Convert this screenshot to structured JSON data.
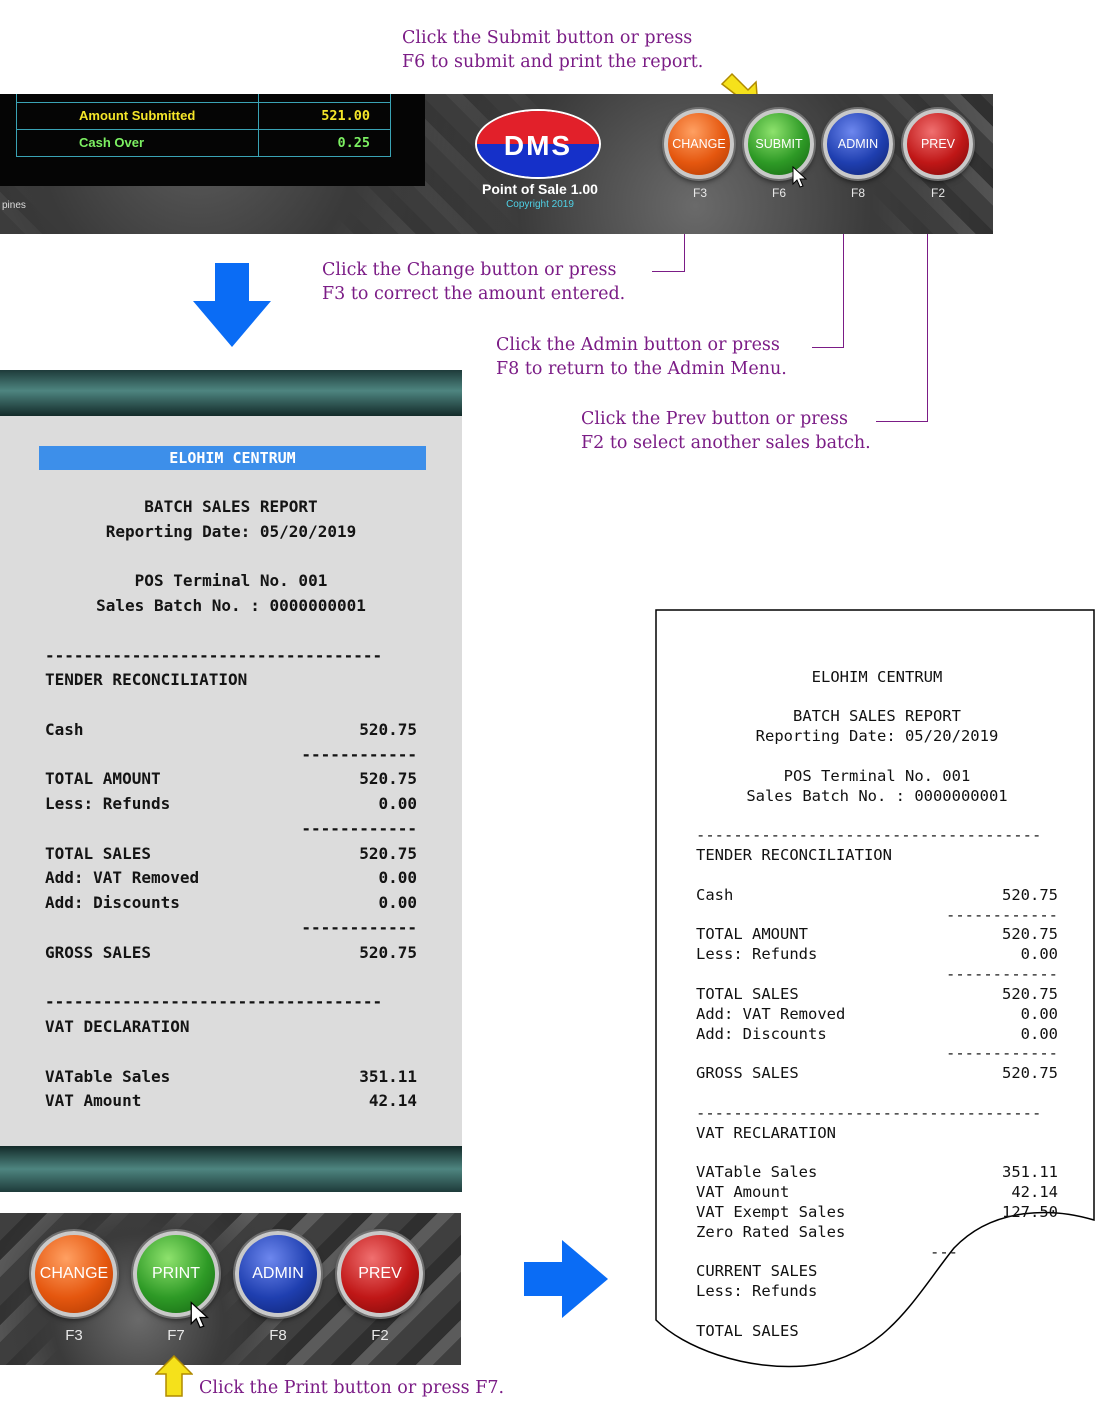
{
  "callouts": {
    "submit": "Click the Submit button or press\nF6 to submit and print the report.",
    "change": "Click the Change button or press\nF3 to correct the amount entered.",
    "admin": "Click the Admin button or press\nF8 to return to the Admin Menu.",
    "prev": "Click the Prev button or press\nF2 to select another sales batch.",
    "print": "Click the Print button or press F7."
  },
  "top_summary": {
    "amount_submitted_label": "Amount Submitted",
    "amount_submitted_value": "521.00",
    "cash_over_label": "Cash Over",
    "cash_over_value": "0.25",
    "left_fragment": "pines"
  },
  "logo": {
    "text": "DMS",
    "caption": "Point of Sale 1.00",
    "copyright": "Copyright 2019"
  },
  "top_buttons": [
    {
      "label": "CHANGE",
      "key": "F3"
    },
    {
      "label": "SUBMIT",
      "key": "F6"
    },
    {
      "label": "ADMIN",
      "key": "F8"
    },
    {
      "label": "PREV",
      "key": "F2"
    }
  ],
  "screen_report": {
    "store": "ELOHIM CENTRUM",
    "title": "BATCH SALES REPORT",
    "reporting_date": "Reporting Date: 05/20/2019",
    "terminal": "POS Terminal No. 001",
    "batch": "Sales Batch No. : 0000000001",
    "dash_long": "-----------------------------------",
    "dash_short": "------------",
    "tender_header": "TENDER RECONCILIATION",
    "cash_label": "Cash",
    "cash_value": "520.75",
    "total_amount_label": "TOTAL AMOUNT",
    "total_amount_value": "520.75",
    "refunds_label": "Less: Refunds",
    "refunds_value": "0.00",
    "total_sales_label": "TOTAL SALES",
    "total_sales_value": "520.75",
    "vat_removed_label": "Add: VAT Removed",
    "vat_removed_value": "0.00",
    "discounts_label": "Add: Discounts",
    "discounts_value": "0.00",
    "gross_label": "GROSS SALES",
    "gross_value": "520.75",
    "vat_header": "VAT DECLARATION",
    "vatable_label": "VATable Sales",
    "vatable_value": "351.11",
    "vat_amount_label": "VAT Amount",
    "vat_amount_value": "42.14"
  },
  "bottom_buttons": [
    {
      "label": "CHANGE",
      "key": "F3"
    },
    {
      "label": "PRINT",
      "key": "F7"
    },
    {
      "label": "ADMIN",
      "key": "F8"
    },
    {
      "label": "PREV",
      "key": "F2"
    }
  ],
  "receipt": {
    "store": "ELOHIM CENTRUM",
    "title": "BATCH SALES REPORT",
    "reporting_date": "Reporting Date: 05/20/2019",
    "terminal": "POS Terminal No. 001",
    "batch": "Sales Batch No. : 0000000001",
    "dash_long": "-------------------------------------",
    "dash_short": "------------",
    "dash_tail": "---",
    "tender_header": "TENDER RECONCILIATION",
    "cash_label": "Cash",
    "cash_value": "520.75",
    "total_amount_label": "TOTAL AMOUNT",
    "total_amount_value": "520.75",
    "refunds_label": "Less: Refunds",
    "refunds_value": "0.00",
    "total_sales_label": "TOTAL SALES",
    "total_sales_value": "520.75",
    "vat_removed_label": "Add: VAT Removed",
    "vat_removed_value": "0.00",
    "discounts_label": "Add: Discounts",
    "discounts_value": "0.00",
    "gross_label": "GROSS SALES",
    "gross_value": "520.75",
    "vat_header": "VAT RECLARATION",
    "vatable_label": "VATable Sales",
    "vatable_value": "351.11",
    "vat_amount_label": "VAT Amount",
    "vat_amount_value": "42.14",
    "vat_exempt_label": "VAT Exempt Sales",
    "vat_exempt_value": "127.50",
    "zero_rated_label": "Zero Rated Sales",
    "current_sales_label": "CURRENT SALES",
    "refunds2_label": "Less: Refunds",
    "total_sales2_label": "TOTAL SALES"
  },
  "colors": {
    "callout_text": "#7b1c86",
    "arrow_blue": "#0a6cf5",
    "pointer_yellow": "#f5e11b"
  }
}
